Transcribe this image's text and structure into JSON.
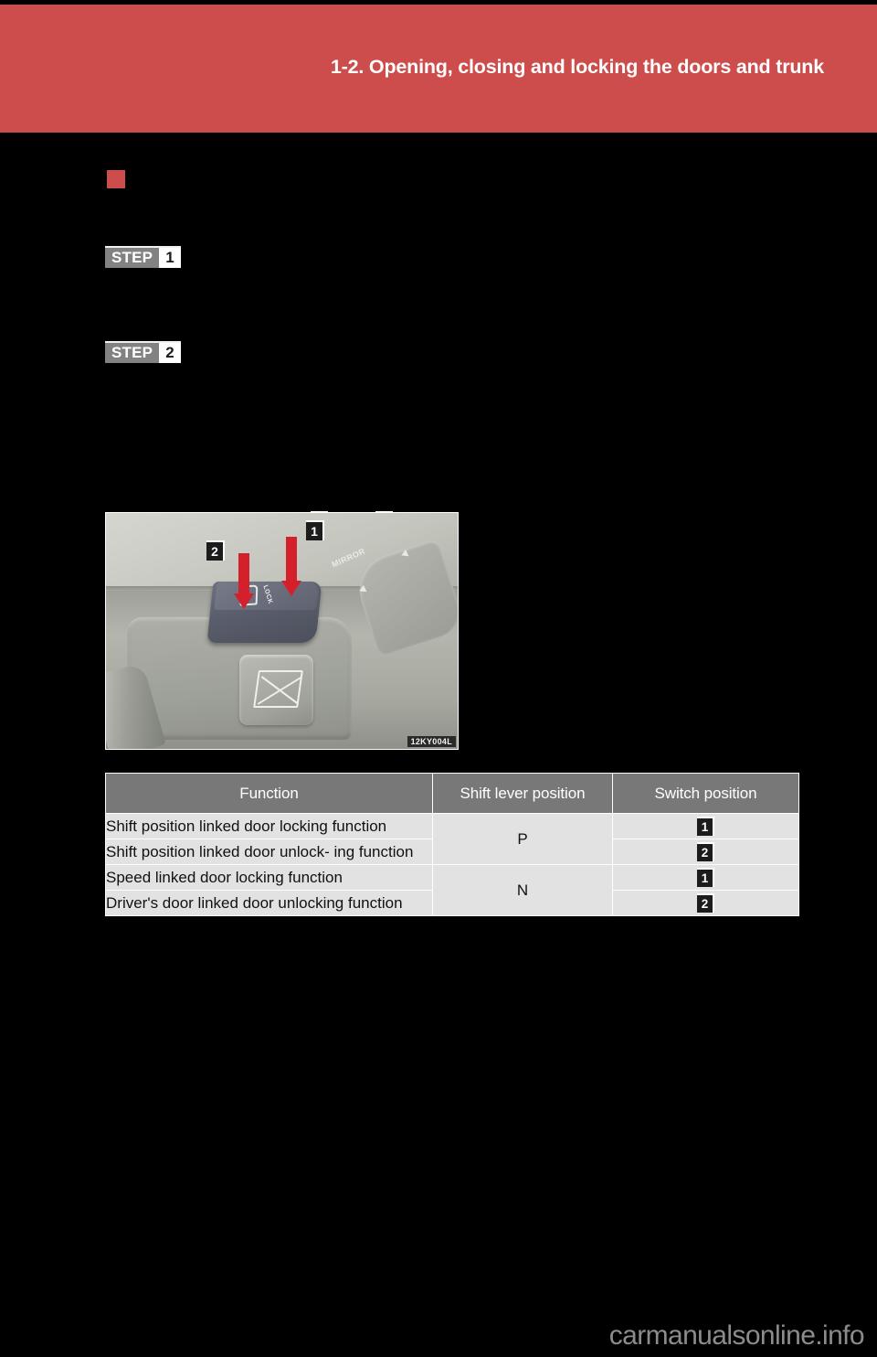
{
  "header": {
    "chapter_title": "1-2. Opening, closing and locking the doors and trunk",
    "tab_number": "1",
    "band_color": "#cd4c4c"
  },
  "section": {
    "bullet_color": "#cd4c4c",
    "heading": ""
  },
  "steps": [
    {
      "word": "STEP",
      "number": "1",
      "text": ""
    },
    {
      "word": "STEP",
      "number": "2",
      "text": ""
    }
  ],
  "inline_markers": {
    "first": "1",
    "second": "2"
  },
  "figure": {
    "caption_code": "12KY004L",
    "marker_1": "1",
    "marker_2": "2",
    "lock_label": "LOCK",
    "mirror_label": "MIRROR",
    "alt": "Door lock switch on driver door armrest with two red arrows"
  },
  "table": {
    "headers": [
      "Function",
      "Shift lever position",
      "Switch position"
    ],
    "rows": [
      {
        "function": "Shift position linked door locking function",
        "shift": "P",
        "shift_rowspan": 2,
        "switch": "1"
      },
      {
        "function": "Shift position linked door unlock- ing function",
        "switch": "2"
      },
      {
        "function": "Speed linked door locking function",
        "shift": "N",
        "shift_rowspan": 2,
        "switch": "1"
      },
      {
        "function": "Driver's door linked door unlocking function",
        "switch": "2"
      }
    ]
  },
  "watermark": {
    "text": "carmanualsonline.info"
  }
}
